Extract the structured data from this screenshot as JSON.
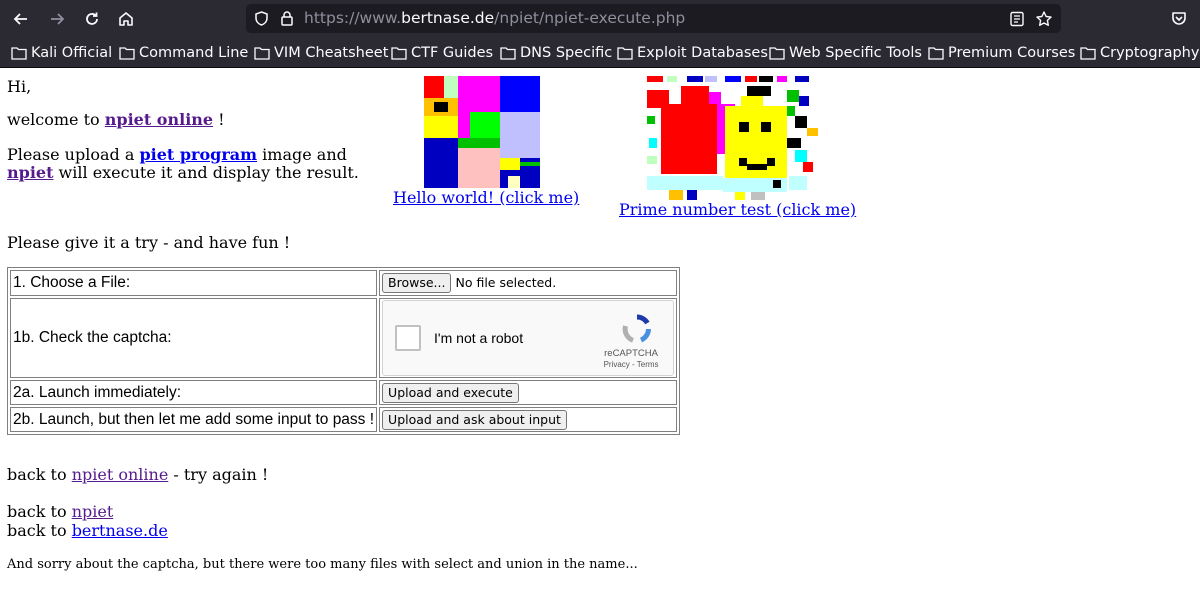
{
  "browser": {
    "url_prefix": "https://www.",
    "url_host": "bertnase.de",
    "url_path": "/npiet/npiet-execute.php",
    "bookmarks": [
      "Kali Official",
      "Command Line",
      "VIM Cheatsheet",
      "CTF Guides",
      "DNS Specific",
      "Exploit Databases",
      "Web Specific Tools",
      "Premium Courses",
      "Cryptography"
    ]
  },
  "intro": {
    "greeting": "Hi,",
    "welcome_pre": "welcome to",
    "welcome_link": "npiet online",
    "welcome_post": " !",
    "upload_pre": "Please upload a",
    "piet_program_link": "piet program",
    "upload_post": " image and",
    "npiet_link": "npiet",
    "execute_post": " will execute it and display the result."
  },
  "examples": {
    "hello_caption": "Hello world! (click me)",
    "prime_caption": "Prime number test (click me)"
  },
  "try_text": "Please give it a try - and have fun !",
  "form": {
    "row1_label": "1. Choose a File:",
    "browse_label": "Browse...",
    "no_file_text": "No file selected.",
    "row1b_label": "1b. Check the captcha:",
    "captcha_label": "I'm not a robot",
    "captcha_brand": "reCAPTCHA",
    "captcha_terms": "Privacy - Terms",
    "row2a_label": "2a. Launch immediately:",
    "upload_execute_label": "Upload and execute",
    "row2b_label": "2b. Launch, but then let me add some input to pass !",
    "upload_ask_label": "Upload and ask about input"
  },
  "footer": {
    "back_prefix": "back to",
    "online_link": "npiet online",
    "try_again": " - try again !",
    "npiet_link": "npiet",
    "bertnase_link": "bertnase.de",
    "sorry_text": "And sorry about the captcha, but there were too many files with select and union in the name..."
  },
  "colors": {
    "chrome": "#2b2a33",
    "link": "#0000ee",
    "visited": "#551a8b"
  }
}
